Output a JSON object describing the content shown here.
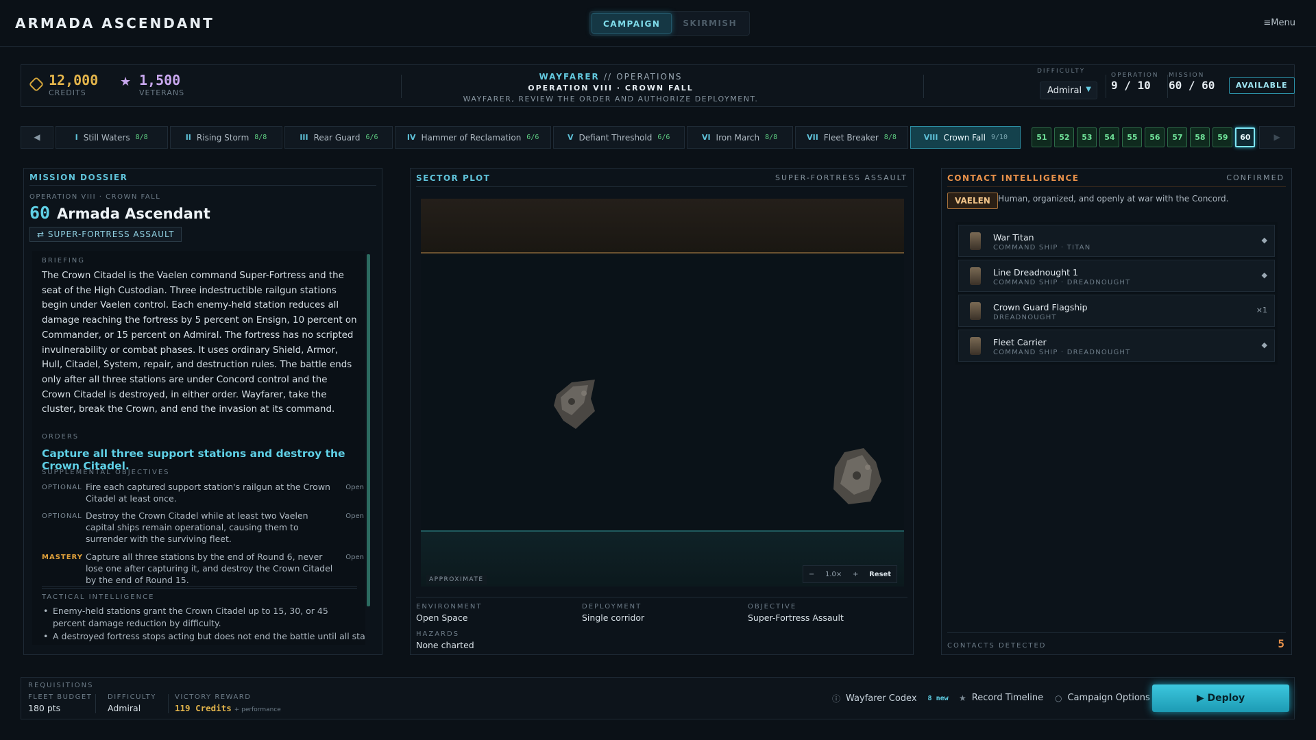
{
  "header": {
    "title": "ARMADA ASCENDANT",
    "modes": [
      "CAMPAIGN",
      "SKIRMISH"
    ],
    "active_mode": "CAMPAIGN",
    "menu_label": "Menu"
  },
  "resources": {
    "credits_value": "12,000",
    "credits_label": "CREDITS",
    "veterans_value": "1,500",
    "veterans_label": "VETERANS"
  },
  "operations_header": {
    "brand": "WAYFARER",
    "sep": "//",
    "section": "OPERATIONS",
    "operation": "OPERATION VIII · CROWN FALL",
    "instruction": "WAYFARER, REVIEW THE ORDER AND AUTHORIZE DEPLOYMENT."
  },
  "status": {
    "difficulty_label": "DIFFICULTY",
    "difficulty_value": "Admiral",
    "operation_label": "OPERATION",
    "operation_value": "9 / 10",
    "mission_label": "MISSION",
    "mission_value": "60 / 60",
    "availability": "AVAILABLE"
  },
  "chapters": [
    {
      "num": "I",
      "name": "Still Waters",
      "count": "8/8"
    },
    {
      "num": "II",
      "name": "Rising Storm",
      "count": "8/8"
    },
    {
      "num": "III",
      "name": "Rear Guard",
      "count": "6/6"
    },
    {
      "num": "IV",
      "name": "Hammer of Reclamation",
      "count": "6/6"
    },
    {
      "num": "V",
      "name": "Defiant Threshold",
      "count": "6/6"
    },
    {
      "num": "VI",
      "name": "Iron March",
      "count": "8/8"
    },
    {
      "num": "VII",
      "name": "Fleet Breaker",
      "count": "8/8"
    },
    {
      "num": "VIII",
      "name": "Crown Fall",
      "count": "9/10"
    }
  ],
  "chapter_nav": {
    "prev": "◀",
    "next": "▶"
  },
  "missions": [
    "51",
    "52",
    "53",
    "54",
    "55",
    "56",
    "57",
    "58",
    "59",
    "60"
  ],
  "selected_mission": "60",
  "dossier": {
    "heading": "MISSION DOSSIER",
    "op_sub": "OPERATION VIII · CROWN FALL",
    "number": "60",
    "name": "Armada Ascendant",
    "type_tag": "SUPER-FORTRESS ASSAULT",
    "briefing_label": "BRIEFING",
    "briefing": "The Crown Citadel is the Vaelen command Super-Fortress and the seat of the High Custodian. Three indestructible railgun stations begin under Vaelen control. Each enemy-held station reduces all damage reaching the fortress by 5 percent on Ensign, 10 percent on Commander, or 15 percent on Admiral. The fortress has no scripted invulnerability or combat phases. It uses ordinary Shield, Armor, Hull, Citadel, System, repair, and destruction rules. The battle ends only after all three stations are under Concord control and the Crown Citadel is destroyed, in either order. Wayfarer, take the cluster, break the Crown, and end the invasion at its command.",
    "orders_label": "ORDERS",
    "orders": "Capture all three support stations and destroy the Crown Citadel.",
    "supplemental_label": "SUPPLEMENTAL OBJECTIVES",
    "objectives": [
      {
        "kind": "OPTIONAL",
        "text": "Fire each captured support station's railgun at the Crown Citadel at least once.",
        "state": "Open"
      },
      {
        "kind": "OPTIONAL",
        "text": "Destroy the Crown Citadel while at least two Vaelen capital ships remain operational, causing them to surrender with the surviving fleet.",
        "state": "Open"
      },
      {
        "kind": "MASTERY",
        "text": "Capture all three stations by the end of Round 6, never lose one after capturing it, and destroy the Crown Citadel by the end of Round 15.",
        "state": "Open"
      }
    ],
    "tactical_label": "TACTICAL INTELLIGENCE",
    "tactical": [
      "Enemy-held stations grant the Crown Citadel up to 15, 30, or 45 percent damage reduction by difficulty.",
      "A destroyed fortress stops acting but does not end the battle until all stations"
    ]
  },
  "sector": {
    "heading": "SECTOR PLOT",
    "type": "SUPER-FORTRESS ASSAULT",
    "approx": "APPROXIMATE",
    "zoom_minus": "−",
    "zoom_value": "1.0×",
    "zoom_plus": "+",
    "reset": "Reset",
    "meta": {
      "environment_label": "ENVIRONMENT",
      "environment": "Open Space",
      "deployment_label": "DEPLOYMENT",
      "deployment": "Single corridor",
      "objective_label": "OBJECTIVE",
      "objective": "Super-Fortress Assault",
      "hazards_label": "HAZARDS",
      "hazards": "None charted"
    }
  },
  "contact": {
    "heading": "CONTACT INTELLIGENCE",
    "status": "CONFIRMED",
    "faction": "VAELEN",
    "faction_desc": "Human, organized, and openly at war with the Concord.",
    "ships": [
      {
        "name": "War Titan",
        "class": "COMMAND SHIP · TITAN",
        "right": "◆"
      },
      {
        "name": "Line Dreadnought 1",
        "class": "COMMAND SHIP · DREADNOUGHT",
        "right": "◆"
      },
      {
        "name": "Crown Guard Flagship",
        "class": "DREADNOUGHT",
        "right": "×1"
      },
      {
        "name": "Fleet Carrier",
        "class": "COMMAND SHIP · DREADNOUGHT",
        "right": "◆"
      }
    ],
    "detected_label": "CONTACTS DETECTED",
    "detected_value": "5"
  },
  "footer": {
    "requisitions": "REQUISITIONS",
    "budget_label": "FLEET BUDGET",
    "budget": "180 pts",
    "difficulty_label": "DIFFICULTY",
    "difficulty": "Admiral",
    "reward_label": "VICTORY REWARD",
    "reward": "119 Credits",
    "reward_note": "+ performance",
    "codex": "Wayfarer Codex",
    "codex_new": "8 new",
    "timeline": "Record Timeline",
    "options": "Campaign Options",
    "deploy": "Deploy"
  },
  "colors": {
    "accent": "#5fd0e6",
    "gold": "#e2b44b",
    "veteran": "#c9a8ef",
    "enemy": "#e8914a",
    "complete": "#5fd083"
  }
}
